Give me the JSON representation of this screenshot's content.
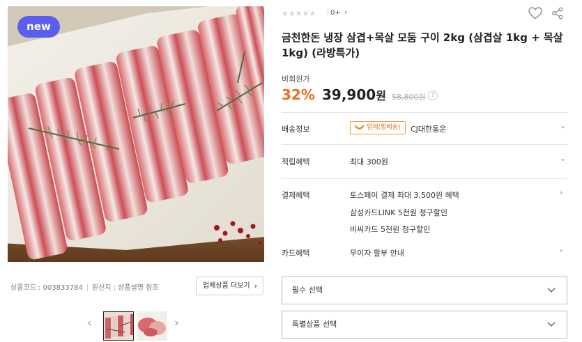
{
  "gallery": {
    "badge": "new",
    "product_code": "상품코드 : 003833784",
    "origin": "원산지 : 상품설명 참조",
    "more_button": "업체상품 더보기"
  },
  "rating": {
    "stars": "★★★★★",
    "count": "0+"
  },
  "product": {
    "title": "금천한돈 냉장 삼겹+목살 모둠 구이 2kg (삼겹살 1kg + 목살 1kg) (라방특가)",
    "price_label": "비회원가",
    "discount": "32",
    "discount_unit": "%",
    "price": "39,900",
    "price_unit": "원",
    "original_price": "58,800원"
  },
  "info": {
    "shipping_label": "배송정보",
    "shipping_badge": "업체(합배송)",
    "shipping_carrier": "CJ대한통운",
    "points_label": "적립혜택",
    "points_value": "최대 300원",
    "payment_label": "결제혜택",
    "payment_lines": [
      "토스페이 결제 최대 3,500원 혜택",
      "삼성카드LINK 5천원 청구할인",
      "비씨카드 5천원 청구할인"
    ],
    "card_label": "카드혜택",
    "card_value": "무이자 할부 안내"
  },
  "options": {
    "required": "필수 선택",
    "special": "특별상품 선택"
  },
  "colors": {
    "accent": "#ef6d1e",
    "badge": "#5b5ff0"
  }
}
